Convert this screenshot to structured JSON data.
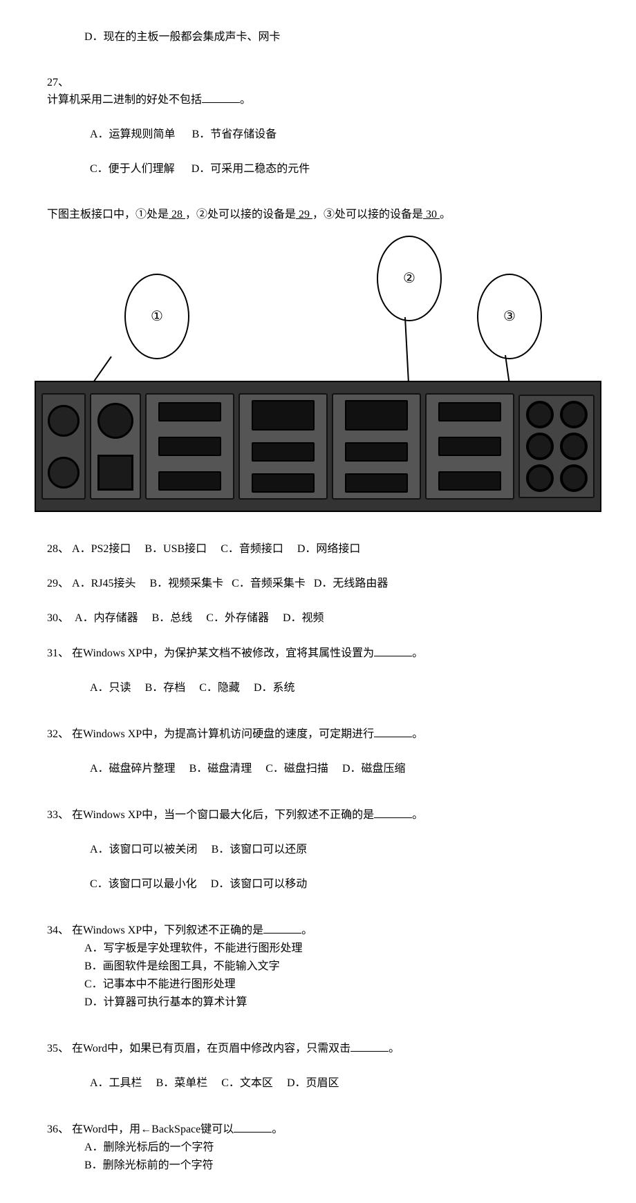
{
  "partial_q": {
    "option_d": "D．现在的主板一般都会集成声卡、网卡"
  },
  "q27": {
    "num": "27、",
    "stem": "计算机采用二进制的好处不包括",
    "tail": "。",
    "a": "A．运算规则简单",
    "b": "B．节省存储设备",
    "c": "C．便于人们理解",
    "d": "D．可采用二稳态的元件"
  },
  "fig_intro": {
    "pre": "下图主板接口中，①处是",
    "u1": " 28 ",
    "mid1": "，②处可以接的设备是",
    "u2": " 29 ",
    "mid2": "，③处可以接的设备是",
    "u3": " 30 ",
    "tail": "。"
  },
  "callouts": {
    "c1": "①",
    "c2": "②",
    "c3": "③"
  },
  "q28": {
    "num": "28、",
    "a": "A．PS2接口",
    "b": "B．USB接口",
    "c": "C．音频接口",
    "d": "D．网络接口"
  },
  "q29": {
    "num": "29、",
    "a": "A．RJ45接头",
    "b": "B．视频采集卡",
    "c": "C．音频采集卡",
    "d": "D．无线路由器"
  },
  "q30": {
    "num": "30、",
    "a": "A．内存储器",
    "b": "B．总线",
    "c": "C．外存储器",
    "d": "D．视频"
  },
  "q31": {
    "num": "31、",
    "stem": "在Windows XP中，为保护某文档不被修改，宜将其属性设置为",
    "tail": "。",
    "a": "A．只读",
    "b": "B．存档",
    "c": "C．隐藏",
    "d": "D．系统"
  },
  "q32": {
    "num": "32、",
    "stem": "在Windows XP中，为提高计算机访问硬盘的速度，可定期进行",
    "tail": "。",
    "a": "A．磁盘碎片整理",
    "b": "B．磁盘清理",
    "c": "C．磁盘扫描",
    "d": "D．磁盘压缩"
  },
  "q33": {
    "num": "33、",
    "stem": "在Windows XP中，当一个窗口最大化后，下列叙述不正确的是",
    "tail": "。",
    "a": "A．该窗口可以被关闭",
    "b": "B．该窗口可以还原",
    "c": "C．该窗口可以最小化",
    "d": "D．该窗口可以移动"
  },
  "q34": {
    "num": "34、",
    "stem": "在Windows XP中，下列叙述不正确的是",
    "tail": "。",
    "a": "A．写字板是字处理软件，不能进行图形处理",
    "b": "B．画图软件是绘图工具，不能输入文字",
    "c": "C．记事本中不能进行图形处理",
    "d": "D．计算器可执行基本的算术计算"
  },
  "q35": {
    "num": "35、",
    "stem": "在Word中，如果已有页眉，在页眉中修改内容，只需双击",
    "tail": "。",
    "a": "A．工具栏",
    "b": "B．菜单栏",
    "c": "C．文本区",
    "d": "D．页眉区"
  },
  "q36": {
    "num": "36、",
    "stem": "在Word中，用←BackSpace键可以",
    "tail": "。",
    "a": "A．删除光标后的一个字符",
    "b": "B．删除光标前的一个字符"
  }
}
